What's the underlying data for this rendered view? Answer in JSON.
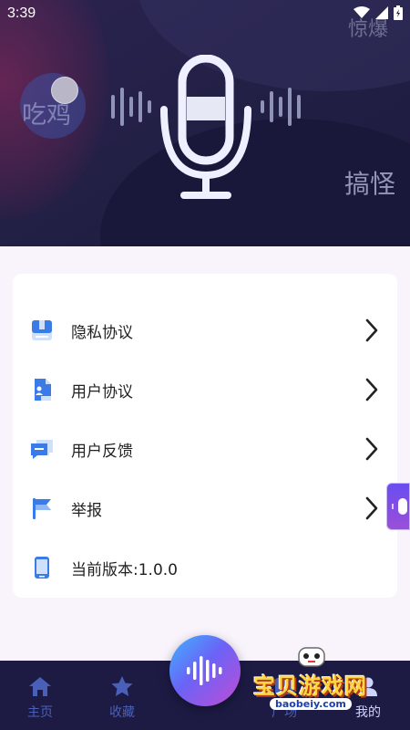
{
  "status_bar": {
    "time": "3:39"
  },
  "banner": {
    "tags": {
      "chiji": "吃鸡",
      "jingbao": "惊爆",
      "gaoguai": "搞怪"
    }
  },
  "menu": {
    "items": [
      {
        "label": "隐私协议",
        "icon": "privacy-book-icon"
      },
      {
        "label": "用户协议",
        "icon": "user-agreement-doc-icon"
      },
      {
        "label": "用户反馈",
        "icon": "feedback-chat-icon"
      },
      {
        "label": "举报",
        "icon": "report-flag-icon"
      }
    ],
    "version_label": "当前版本:1.0.0"
  },
  "bottom_nav": {
    "home": "主页",
    "favorites": "收藏",
    "square": "广场",
    "mine": "我的"
  },
  "watermark": {
    "title": "宝贝游戏网",
    "url": "baobeiy.com"
  },
  "colors": {
    "banner_bg": "#232046",
    "nav_bg": "#1d1b44",
    "nav_inactive": "#4a60b8",
    "icon_blue": "#3a7be8",
    "accent_gradient_start": "#3fb3ff",
    "accent_gradient_end": "#c04cd6"
  }
}
